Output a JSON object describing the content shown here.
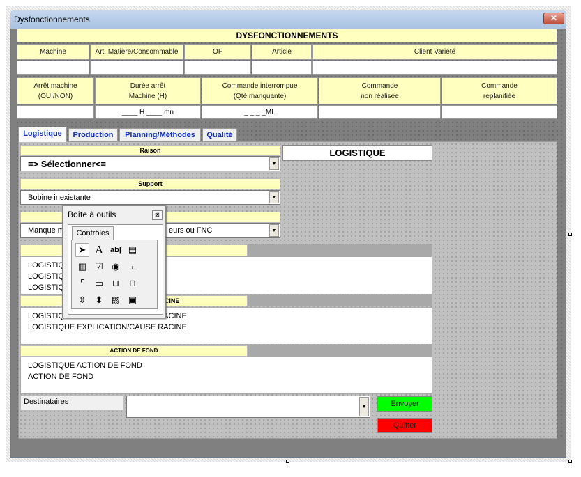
{
  "window": {
    "title": "Dysfonctionnements",
    "close_icon": "close-icon"
  },
  "header": {
    "title": "DYSFONCTIONNEMENTS",
    "row1": [
      {
        "label": "Machine",
        "value": ""
      },
      {
        "label": "Art. Matière/Consommable",
        "value": ""
      },
      {
        "label": "OF",
        "value": ""
      },
      {
        "label": "Article",
        "value": ""
      },
      {
        "label": "Client Variété",
        "value": ""
      }
    ],
    "row2": [
      {
        "label1": "Arrêt machine",
        "label2": "(OUI/NON)",
        "value": ""
      },
      {
        "label1": "Durée arrêt",
        "label2": "Machine (H)",
        "value": "____ H ____ mn"
      },
      {
        "label1": "Commande interrompue",
        "label2": "(Qté manquante)",
        "value": "_ _ _ _ML"
      },
      {
        "label1": "Commande",
        "label2": "non réalisée",
        "value": ""
      },
      {
        "label1": "Commande",
        "label2": "replanifiée",
        "value": ""
      }
    ]
  },
  "tabs": [
    {
      "label": "Logistique",
      "active": true
    },
    {
      "label": "Production"
    },
    {
      "label": "Planning/Méthodes"
    },
    {
      "label": "Qualité"
    }
  ],
  "logistique": {
    "section_label": "LOGISTIQUE",
    "raison": {
      "label": "Raison",
      "value": "=> Sélectionner<="
    },
    "support": {
      "label": "Support",
      "value": "Bobine inexistante"
    },
    "third": {
      "value_start": "Manque m",
      "value_end": "eurs ou FNC"
    },
    "text1": [
      "LOGISTIQ",
      "LOGISTIQ",
      "LOGISTIQ"
    ],
    "cause": {
      "label": "EXPLICATION/CAUSE RACINE",
      "lines": [
        "LOGISTIQUE EXPLICATION/CAUSE RACINE",
        "LOGISTIQUE EXPLICATION/CAUSE RACINE"
      ]
    },
    "action": {
      "label": "ACTION DE FOND",
      "lines": [
        "LOGISTIQUE ACTION DE FOND",
        "ACTION DE FOND"
      ]
    },
    "destinataires": {
      "label": "Destinataires",
      "value": ""
    },
    "send": "Envoyer",
    "quit": "Quitter"
  },
  "colors": {
    "send": "#00ff00",
    "quit": "#ff0000",
    "header_bg": "#ffffc0",
    "tab_text": "#1030c0"
  },
  "toolbox": {
    "title": "Boîte à outils",
    "tab": "Contrôles",
    "icons": [
      "pointer-icon",
      "label-icon",
      "textbox-icon",
      "combobox-icon",
      "listbox-icon",
      "checkbox-icon",
      "optionbutton-icon",
      "togglebutton-icon",
      "frame-icon",
      "commandbutton-icon",
      "tabstrip-icon",
      "multipage-icon",
      "scrollbar-icon",
      "spinbutton-icon",
      "image-icon",
      "refedit-icon"
    ]
  }
}
